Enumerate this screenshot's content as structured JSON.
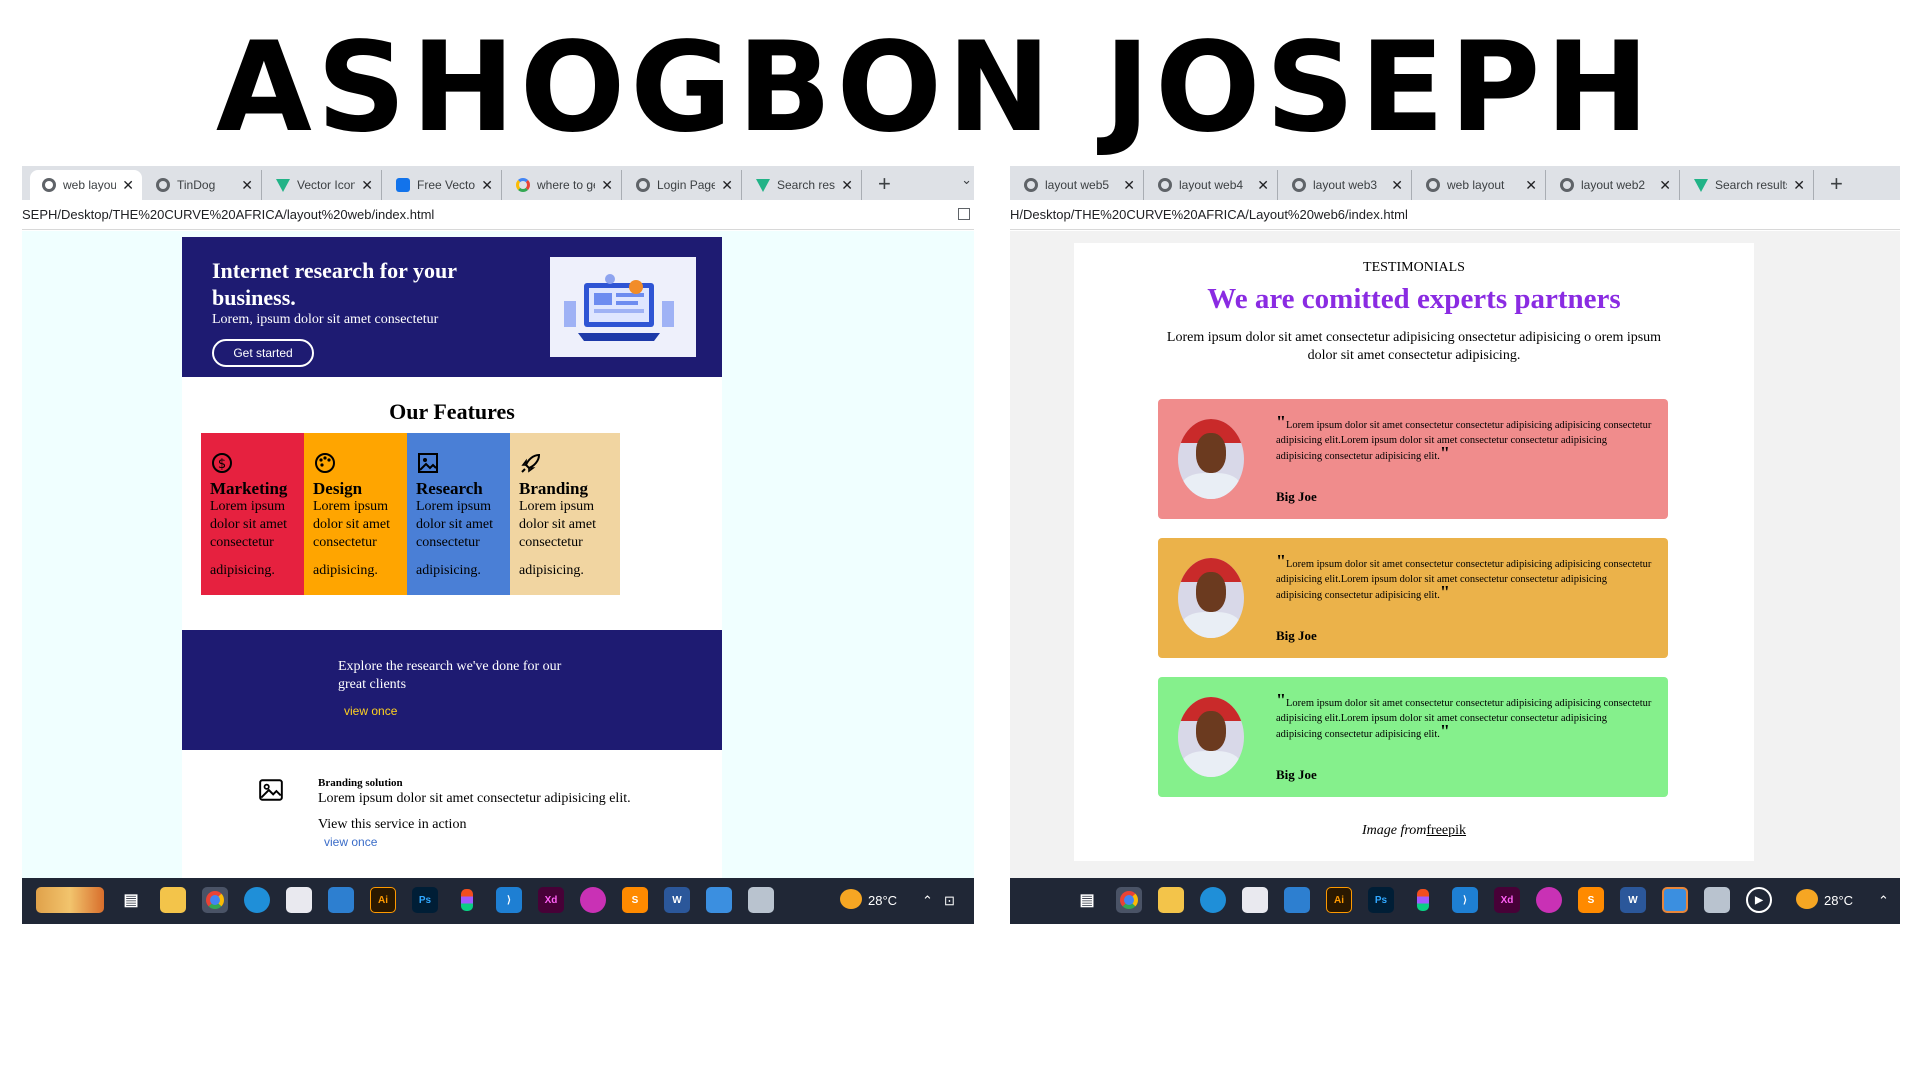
{
  "title": "ASHOGBON JOSEPH",
  "left_window": {
    "tabs": [
      {
        "label": "web layout",
        "icon": "globe-icon",
        "active": true
      },
      {
        "label": "TinDog",
        "icon": "globe-icon"
      },
      {
        "label": "Vector Icons",
        "icon": "vecteezy-icon"
      },
      {
        "label": "Free Vectors",
        "icon": "freepik-icon"
      },
      {
        "label": "where to get",
        "icon": "google-icon"
      },
      {
        "label": "Login Page",
        "icon": "globe-icon"
      },
      {
        "label": "Search results",
        "icon": "vecteezy-icon"
      }
    ],
    "url": "SEPH/Desktop/THE%20CURVE%20AFRICA/layout%20web/index.html",
    "page": {
      "hero": {
        "title": "Internet research for your business.",
        "subtitle": "Lorem, ipsum dolor sit amet consectetur",
        "button": "Get started"
      },
      "features_title": "Our Features",
      "features": [
        {
          "title": "Marketing",
          "text": "Lorem ipsum dolor sit amet consectetur",
          "text2": "adipisicing.",
          "color": "#e6213f",
          "icon": "dollar-icon"
        },
        {
          "title": "Design",
          "text": "Lorem ipsum dolor sit amet consectetur",
          "text2": "adipisicing.",
          "color": "#ffa500",
          "icon": "palette-icon"
        },
        {
          "title": "Research",
          "text": "Lorem ipsum dolor sit amet consectetur",
          "text2": "adipisicing.",
          "color": "#4a7fd6",
          "icon": "image-icon"
        },
        {
          "title": "Branding",
          "text": "Lorem ipsum dolor sit amet consectetur",
          "text2": "adipisicing.",
          "color": "#f1d5a1",
          "icon": "rocket-icon"
        }
      ],
      "explore": {
        "text": "Explore the research we've done for our great clients",
        "link": "view once"
      },
      "branding": {
        "title": "Branding solution",
        "text": "Lorem ipsum dolor sit amet consectetur adipisicing elit.",
        "cta": "View this service in action",
        "link": "view once"
      }
    },
    "taskbar": {
      "weather": "28°C"
    }
  },
  "right_window": {
    "tabs": [
      {
        "label": "layout web5",
        "icon": "globe-icon"
      },
      {
        "label": "layout web4",
        "icon": "globe-icon"
      },
      {
        "label": "layout web3",
        "icon": "globe-icon"
      },
      {
        "label": "web layout",
        "icon": "globe-icon"
      },
      {
        "label": "layout web2",
        "icon": "globe-icon"
      },
      {
        "label": "Search results",
        "icon": "vecteezy-icon"
      }
    ],
    "url": "H/Desktop/THE%20CURVE%20AFRICA/Layout%20web6/index.html",
    "page": {
      "eyebrow": "TESTIMONIALS",
      "heading": "We are comitted experts partners",
      "intro": "Lorem ipsum dolor sit amet consectetur adipisicing onsectetur adipisicing o orem ipsum dolor sit amet consectetur adipisicing.",
      "heading_color": "#8a2be2",
      "testimonials": [
        {
          "quote": "Lorem ipsum dolor sit amet consectetur consectetur adipisicing adipisicing consectetur adipisicing elit.Lorem ipsum dolor sit amet consectetur consectetur adipisicing adipisicing consectetur adipisicing elit.",
          "name": "Big Joe",
          "color": "#f08c8c"
        },
        {
          "quote": "Lorem ipsum dolor sit amet consectetur consectetur adipisicing adipisicing consectetur adipisicing elit.Lorem ipsum dolor sit amet consectetur consectetur adipisicing adipisicing consectetur adipisicing elit.",
          "name": "Big Joe",
          "color": "#ebb24a"
        },
        {
          "quote": "Lorem ipsum dolor sit amet consectetur consectetur adipisicing adipisicing consectetur adipisicing elit.Lorem ipsum dolor sit amet consectetur consectetur adipisicing adipisicing consectetur adipisicing elit.",
          "name": "Big Joe",
          "color": "#85f08c"
        }
      ],
      "credit": {
        "label": "Image from",
        "link": "freepik"
      }
    },
    "taskbar": {
      "weather": "28°C"
    }
  }
}
